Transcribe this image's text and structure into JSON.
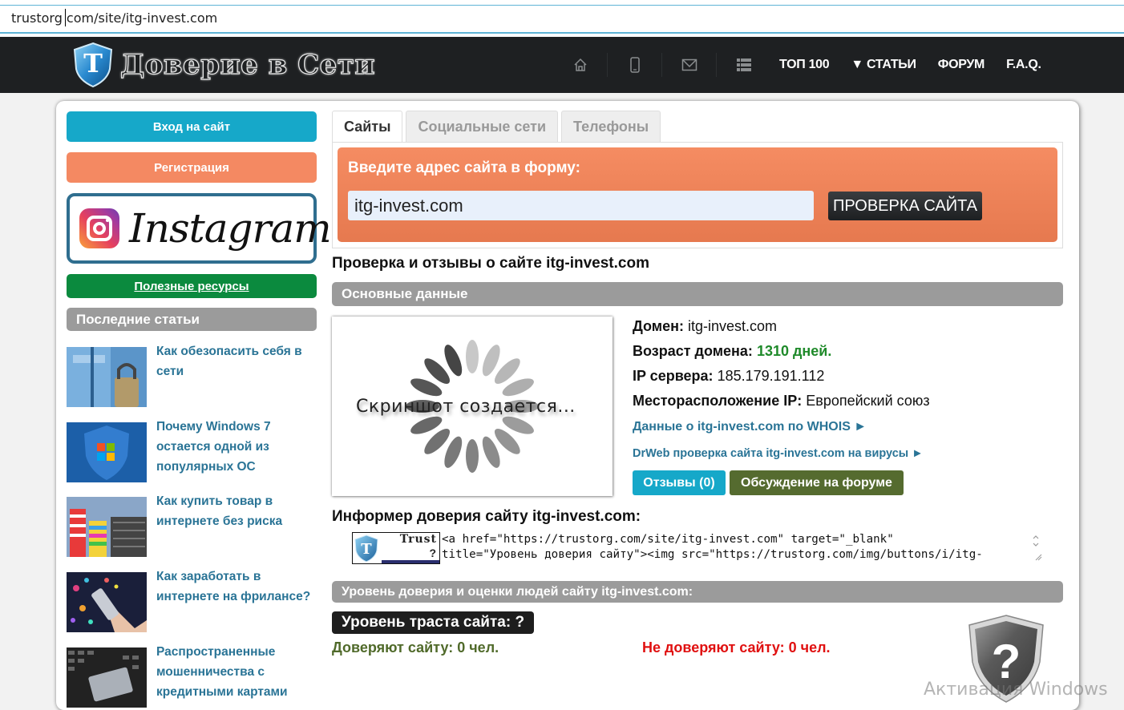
{
  "browser": {
    "url": "trustorg com/site/itg-invest.com"
  },
  "header": {
    "logo_text": "Доверие в Сети",
    "icons": [
      "home-icon",
      "mobile-icon",
      "mail-icon",
      "list-icon"
    ],
    "nav": [
      {
        "label": "ТОП 100"
      },
      {
        "label": "▼ СТАТЬИ"
      },
      {
        "label": "ФОРУМ"
      },
      {
        "label": "F.A.Q."
      }
    ]
  },
  "sidebar": {
    "login_label": "Вход на сайт",
    "register_label": "Регистрация",
    "instagram_label": "Instagram",
    "useful_label": "Полезные ресурсы",
    "recent_header": "Последние статьи",
    "articles": [
      {
        "title": "Как обезопасить себя в сети"
      },
      {
        "title": "Почему Windows 7 остается одной из популярных ОС"
      },
      {
        "title": "Как купить товар в интернете без риска"
      },
      {
        "title": "Как заработать в интернете на фрилансе?"
      },
      {
        "title": "Распространенные мошенничества с кредитными картами"
      }
    ]
  },
  "main": {
    "tabs": [
      {
        "label": "Сайты",
        "active": true
      },
      {
        "label": "Социальные сети",
        "active": false
      },
      {
        "label": "Телефоны",
        "active": false
      }
    ],
    "search": {
      "label": "Введите адрес сайта в форму:",
      "value": "itg-invest.com",
      "button": "ПРОВЕРКА САЙТА"
    },
    "page_title": "Проверка и отзывы о сайте itg-invest.com",
    "basic_header": "Основные данные",
    "screenshot_text": "Скриншот создается...",
    "info": {
      "domain_label": "Домен:",
      "domain_value": "itg-invest.com",
      "age_label": "Возраст домена:",
      "age_value": "1310 дней.",
      "ip_label": "IP сервера:",
      "ip_value": "185.179.191.112",
      "location_label": "Месторасположение IP:",
      "location_value": "Европейский союз"
    },
    "whois_link": "Данные о itg-invest.com по WHOIS ►",
    "drweb_link": "DrWeb проверка сайта itg-invest.com на вирусы ►",
    "reviews_button": "Отзывы (0)",
    "forum_button": "Обсуждение на форуме",
    "informer_title": "Информер доверия сайту itg-invest.com:",
    "informer_badge": {
      "label": "Trust",
      "value": "?"
    },
    "informer_code": "<a href=\"https://trustorg.com/site/itg-invest.com\" target=\"_blank\"\ntitle=\"Уровень доверия сайту\"><img src=\"https://trustorg.com/img/buttons/i/itg-",
    "trust_header": "Уровень доверия и оценки людей сайту itg-invest.com:",
    "trust_level": "Уровень траста сайта: ?",
    "trust_yes": "Доверяют сайту: 0 чел.",
    "trust_no": "Не доверяют сайту: 0 чел."
  },
  "colors": {
    "login": "#16a8c9",
    "register": "#f48962",
    "useful": "#0b8a3e",
    "link": "#2a7496",
    "positive": "#1f8a2a",
    "negative": "#e01010",
    "forum_button": "#556b2f"
  },
  "overlay": {
    "watermark": "Активация Windows"
  }
}
